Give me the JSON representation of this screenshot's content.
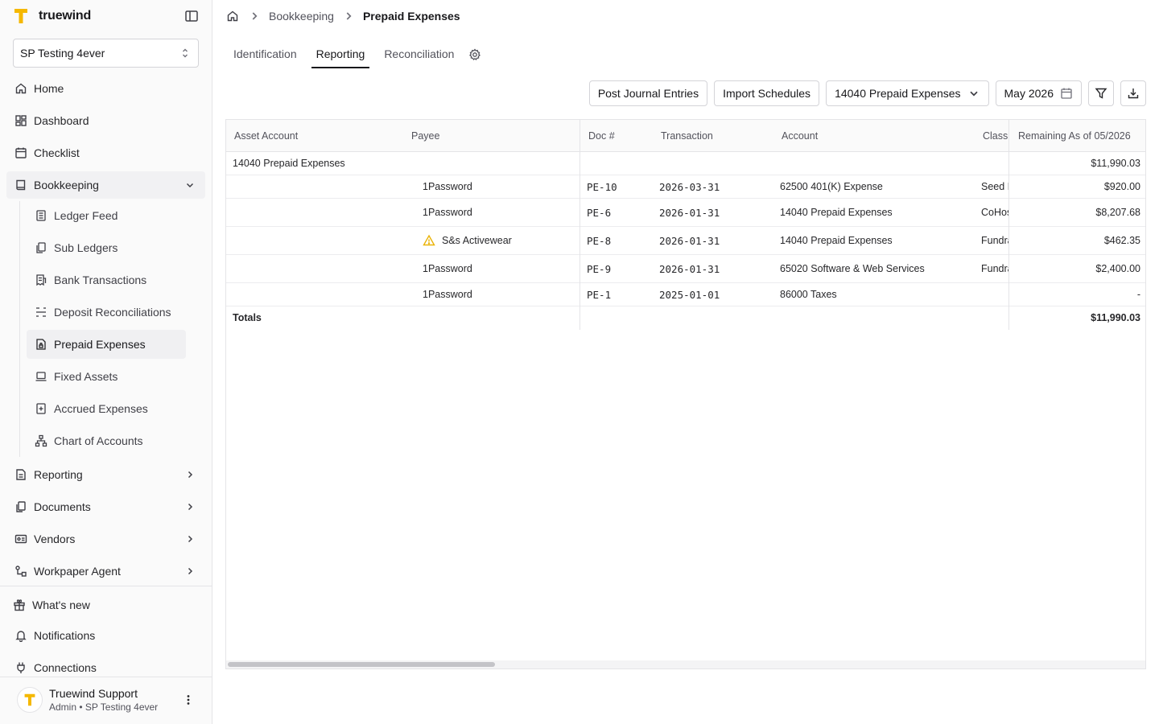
{
  "app": {
    "brand": "truewind"
  },
  "company_selector": {
    "value": "SP Testing 4ever"
  },
  "nav": {
    "home": "Home",
    "dashboard": "Dashboard",
    "checklist": "Checklist",
    "bookkeeping": "Bookkeeping",
    "sub_items": [
      "Ledger Feed",
      "Sub Ledgers",
      "Bank Transactions",
      "Deposit Reconciliations",
      "Prepaid Expenses",
      "Fixed Assets",
      "Accrued Expenses",
      "Chart of Accounts"
    ],
    "reporting": "Reporting",
    "documents": "Documents",
    "vendors": "Vendors",
    "workpaper_agent": "Workpaper Agent",
    "whats_new": "What's new",
    "notifications": "Notifications",
    "connections": "Connections"
  },
  "user": {
    "name": "Truewind Support",
    "role": "Admin • SP Testing 4ever"
  },
  "breadcrumb": {
    "parent": "Bookkeeping",
    "current": "Prepaid Expenses"
  },
  "tabs": [
    "Identification",
    "Reporting",
    "Reconciliation"
  ],
  "toolbar": {
    "post_journal": "Post Journal Entries",
    "import_schedules": "Import Schedules",
    "account_filter": "14040 Prepaid Expenses",
    "period": "May 2026"
  },
  "table": {
    "columns": {
      "asset_account": "Asset Account",
      "payee": "Payee",
      "doc": "Doc #",
      "transaction": "Transaction",
      "account": "Account",
      "class": "Class",
      "remaining": "Remaining As of 05/2026"
    },
    "group": {
      "label": "14040 Prepaid Expenses",
      "remaining": "$11,990.03"
    },
    "rows": [
      {
        "payee": "1Password",
        "doc": "PE-10",
        "date": "2026-03-31",
        "account": "62500 401(K) Expense",
        "class": "Seed I",
        "remaining": "$920.00"
      },
      {
        "payee": "1Password",
        "doc": "PE-6",
        "date": "2026-01-31",
        "account": "14040 Prepaid Expenses",
        "class": "CoHos",
        "remaining": "$8,207.68"
      },
      {
        "payee": "S&s Activewear",
        "doc": "PE-8",
        "date": "2026-01-31",
        "account": "14040 Prepaid Expenses",
        "class": "Fundra",
        "remaining": "$462.35"
      },
      {
        "payee": "1Password",
        "doc": "PE-9",
        "date": "2026-01-31",
        "account": "65020 Software & Web Services",
        "class": "Fundra",
        "remaining": "$2,400.00"
      },
      {
        "payee": "1Password",
        "doc": "PE-1",
        "date": "2025-01-01",
        "account": "86000 Taxes",
        "class": "",
        "remaining": "-"
      }
    ],
    "totals": {
      "label": "Totals",
      "remaining": "$11,990.03"
    }
  },
  "colors": {
    "brand_yellow": "#f5b800",
    "warning": "#eab308"
  }
}
